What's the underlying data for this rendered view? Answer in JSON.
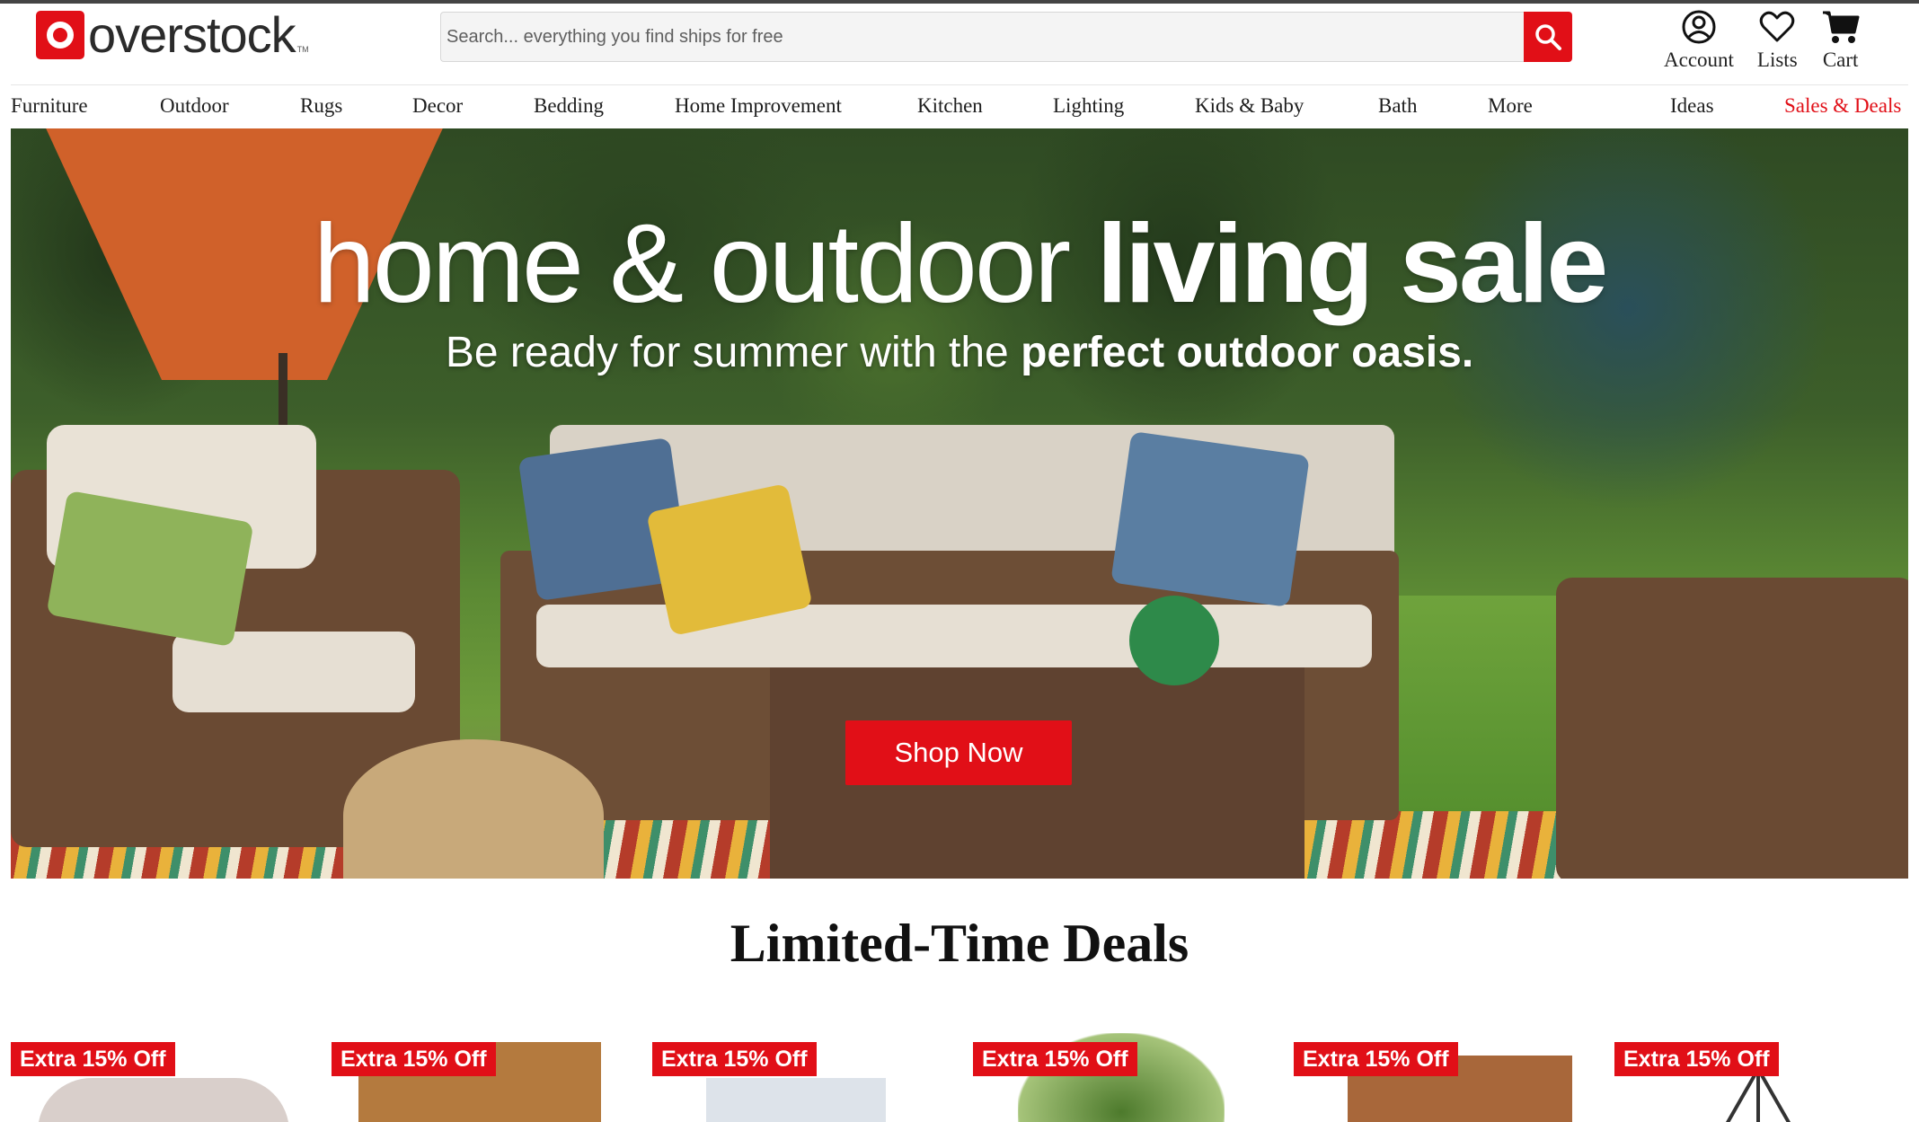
{
  "brand": {
    "name": "overstock",
    "trademark": "TM",
    "accent_color": "#e10f17"
  },
  "search": {
    "placeholder": "Search... everything you find ships for free"
  },
  "header_actions": [
    {
      "label": "Account",
      "icon": "account-icon"
    },
    {
      "label": "Lists",
      "icon": "heart-icon"
    },
    {
      "label": "Cart",
      "icon": "cart-icon"
    }
  ],
  "nav": {
    "items": [
      "Furniture",
      "Outdoor",
      "Rugs",
      "Decor",
      "Bedding",
      "Home Improvement",
      "Kitchen",
      "Lighting",
      "Kids & Baby",
      "Bath",
      "More",
      "Ideas",
      "Sales & Deals"
    ]
  },
  "hero": {
    "title_light": "home & outdoor",
    "title_bold": "living sale",
    "subtitle_light": "Be ready for summer with the",
    "subtitle_bold": "perfect outdoor oasis.",
    "cta": "Shop Now"
  },
  "deals": {
    "title": "Limited-Time Deals",
    "cards": [
      {
        "badge": "Extra 15% Off"
      },
      {
        "badge": "Extra 15% Off"
      },
      {
        "badge": "Extra 15% Off"
      },
      {
        "badge": "Extra 15% Off"
      },
      {
        "badge": "Extra 15% Off"
      },
      {
        "badge": "Extra 15% Off"
      }
    ]
  }
}
